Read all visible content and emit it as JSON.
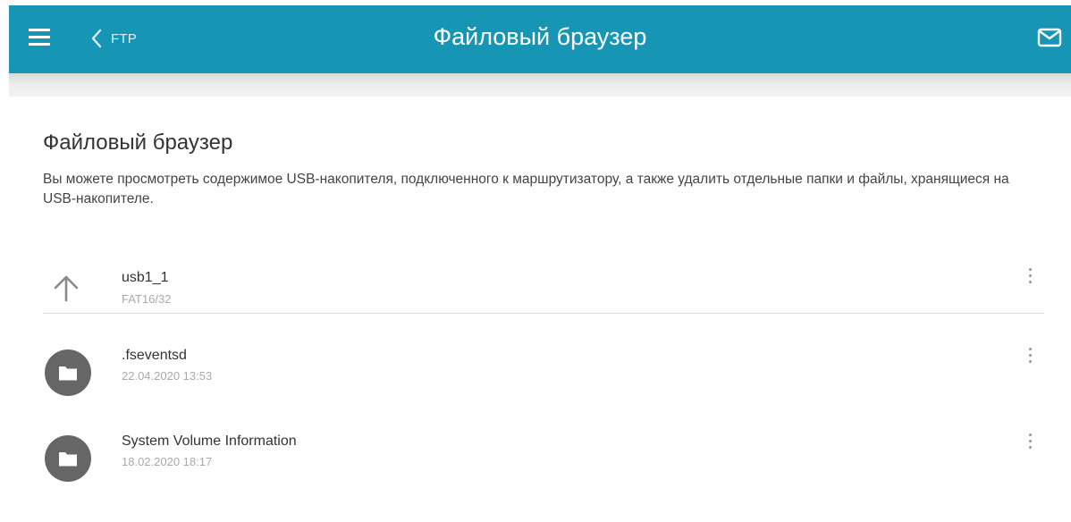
{
  "header": {
    "back_label": "FTP",
    "title": "Файловый браузер",
    "bar_color": "#1795b5"
  },
  "icons": {
    "menu": "hamburger-icon",
    "back": "chevron-left-icon",
    "notifications": "mail-icon",
    "parent": "arrow-up-icon",
    "folder": "folder-icon",
    "actions": "more-vertical-icon"
  },
  "main": {
    "title": "Файловый браузер",
    "description": "Вы можете просмотреть содержимое USB-накопителя, подключенного к маршрутизатору, а также удалить отдельные папки и файлы, хранящиеся на USB-накопителе."
  },
  "files": {
    "parent": {
      "name": "usb1_1",
      "meta": "FAT16/32"
    },
    "items": [
      {
        "name": ".fseventsd",
        "meta": "22.04.2020 13:53"
      },
      {
        "name": "System Volume Information",
        "meta": "18.02.2020 18:17"
      }
    ]
  }
}
